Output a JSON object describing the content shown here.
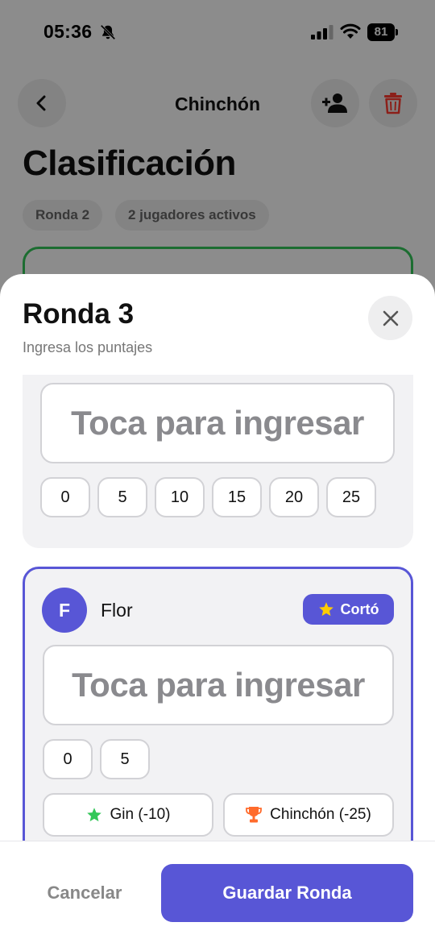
{
  "status_bar": {
    "time": "05:36",
    "battery": "81"
  },
  "nav": {
    "title": "Chinchón"
  },
  "page": {
    "title": "Clasificación",
    "chips": [
      "Ronda 2",
      "2 jugadores activos"
    ]
  },
  "sheet": {
    "title": "Ronda 3",
    "subtitle": "Ingresa los puntajes",
    "players": [
      {
        "name": "",
        "input_placeholder": "Toca para ingresar",
        "quick_values": [
          "0",
          "5",
          "10",
          "15",
          "20",
          "25"
        ]
      },
      {
        "initial": "F",
        "name": "Flor",
        "badge": "Cortó",
        "input_placeholder": "Toca para ingresar",
        "quick_values": [
          "0",
          "5"
        ],
        "bonuses": [
          {
            "label": "Gin (-10)",
            "icon": "star-icon",
            "color": "#34c759"
          },
          {
            "label": "Chinchón (-25)",
            "icon": "trophy-icon",
            "color": "#ff6b2c"
          }
        ]
      }
    ],
    "footer": {
      "cancel_label": "Cancelar",
      "save_label": "Guardar Ronda"
    }
  },
  "colors": {
    "accent": "#5856d6",
    "danger": "#ff3b30",
    "success": "#34c759",
    "badge_star": "#ffcc00"
  }
}
